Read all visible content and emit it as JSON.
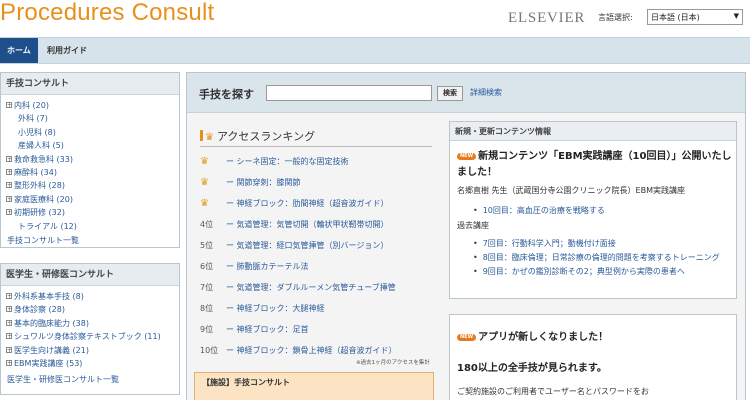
{
  "header": {
    "logo": "Procedures Consult",
    "publisher": "ELSEVIER",
    "language_label": "言語選択:",
    "language_value": "日本語 (日本)"
  },
  "nav": {
    "home": "ホーム",
    "guide": "利用ガイド"
  },
  "sidebar": {
    "procedures": {
      "title": "手技コンサルト",
      "items": [
        {
          "label": "内科 (20)",
          "expandable": true
        },
        {
          "label": "外科 (7)",
          "expandable": false
        },
        {
          "label": "小児科 (8)",
          "expandable": false
        },
        {
          "label": "産婦人科 (5)",
          "expandable": false
        },
        {
          "label": "救命救急科 (33)",
          "expandable": true
        },
        {
          "label": "麻酔科 (34)",
          "expandable": true
        },
        {
          "label": "整形外科 (28)",
          "expandable": true
        },
        {
          "label": "家庭医療科 (20)",
          "expandable": true
        },
        {
          "label": "初期研修 (32)",
          "expandable": true
        },
        {
          "label": "トライアル (12)",
          "expandable": false
        }
      ],
      "footer": "手技コンサルト一覧"
    },
    "residents": {
      "title": "医学生・研修医コンサルト",
      "items": [
        {
          "label": "外科系基本手技 (8)",
          "expandable": true
        },
        {
          "label": "身体診察 (28)",
          "expandable": true
        },
        {
          "label": "基本的臨床能力 (38)",
          "expandable": true
        },
        {
          "label": "シュワルツ身体診察テキストブック (11)",
          "expandable": true
        },
        {
          "label": "医学生向け講義 (21)",
          "expandable": true
        },
        {
          "label": "EBM実践講座 (53)",
          "expandable": true
        }
      ],
      "footer": "医学生・研修医コンサルト一覧"
    }
  },
  "search": {
    "title": "手技を探す",
    "button": "検索",
    "advanced": "詳細検索",
    "value": ""
  },
  "ranking": {
    "title": "アクセスランキング",
    "items": [
      {
        "pos": "",
        "crown": true,
        "text": "ー シーネ固定：一般的な固定技術"
      },
      {
        "pos": "",
        "crown": true,
        "text": "ー 関節穿刺：膝関節"
      },
      {
        "pos": "",
        "crown": true,
        "text": "ー 神経ブロック：肋間神経（超音波ガイド）"
      },
      {
        "pos": "4位",
        "crown": false,
        "text": "ー 気道管理：気管切開（輪状甲状靭帯切開）"
      },
      {
        "pos": "5位",
        "crown": false,
        "text": "ー 気道管理：経口気管挿管（別バージョン）"
      },
      {
        "pos": "6位",
        "crown": false,
        "text": "ー 肺動脈カテーテル法"
      },
      {
        "pos": "7位",
        "crown": false,
        "text": "ー 気道管理：ダブルルーメン気管チューブ挿管"
      },
      {
        "pos": "8位",
        "crown": false,
        "text": "ー 神経ブロック：大腿神経"
      },
      {
        "pos": "9位",
        "crown": false,
        "text": "ー 神経ブロック：足首"
      },
      {
        "pos": "10位",
        "crown": false,
        "text": "ー 神経ブロック：鎖骨上神経（超音波ガイド）"
      }
    ],
    "note": "※過去1ヶ月のアクセスを集計"
  },
  "facility": {
    "title": "【施設】手技コンサルト"
  },
  "news": {
    "title": "新規・更新コンテンツ情報",
    "badge": "NEW",
    "headline": "新規コンテンツ「EBM実践講座（10回目）」公開いたしました！",
    "author": "名郷直樹 先生（武蔵国分寺公園クリニック院長）EBM実践講座",
    "new_item": "10回目：高血圧の治療を戦略する",
    "past_label": "過去講座",
    "past_items": [
      "7回目：行動科学入門；動機付け面接",
      "8回目：臨床倫理；日常診療の倫理的問題を考察するトレーニング",
      "9回目：かぜの鑑別診断その2；典型例から実際の患者へ"
    ]
  },
  "app_notice": {
    "badge": "NEW",
    "title": "アプリが新しくなりました！",
    "subtitle": "180以上の全手技が見られます。",
    "text": "ご契約施設のご利用者でユーザー名とパスワードをお"
  },
  "colors": {
    "accent": "#e8901c",
    "nav_active": "#1f4f8a",
    "link": "#2a5a9a"
  }
}
